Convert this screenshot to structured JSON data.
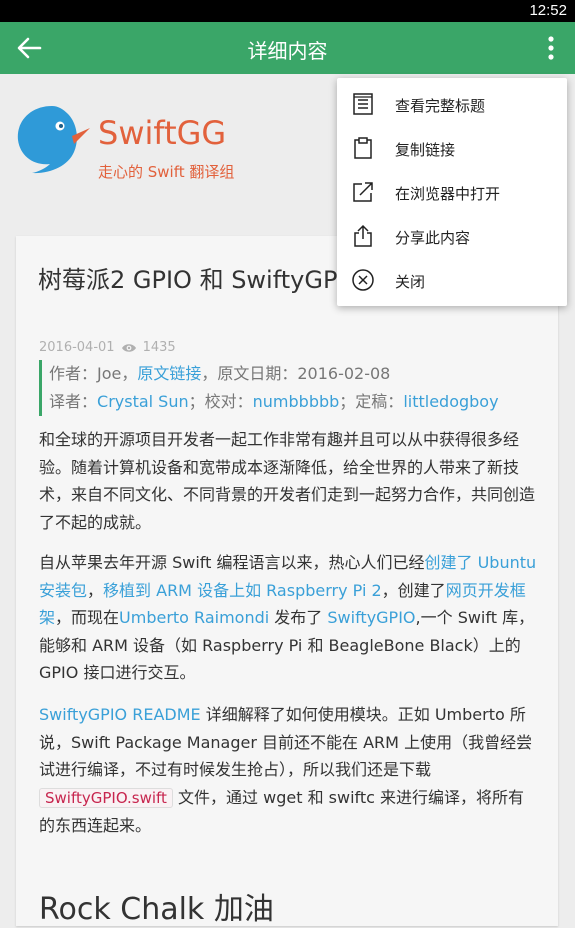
{
  "status_bar": {
    "time": "12:52"
  },
  "app_bar": {
    "title": "详细内容"
  },
  "brand": {
    "name": "SwiftGG",
    "tagline": "走心的 Swift 翻译组"
  },
  "article": {
    "title": "树莓派2 GPIO 和 SwiftyGPIO",
    "date": "2016-04-01",
    "views": "1435",
    "credits": {
      "author_prefix": "作者：Joe，",
      "original_link": "原文链接",
      "original_date": "，原文日期：2016-02-08",
      "translator_prefix": "译者：",
      "translator": "Crystal Sun",
      "proofreader_prefix": "；校对：",
      "proofreader": "numbbbbb",
      "finalizer_prefix": "；定稿：",
      "finalizer": "littledogboy"
    },
    "para1": "和全球的开源项目开发者一起工作非常有趣并且可以从中获得很多经验。随着计算机设备和宽带成本逐渐降低，给全世界的人带来了新技术，来自不同文化、不同背景的开发者们走到一起努力合作，共同创造了不起的成就。",
    "para2": {
      "t1": "自从苹果去年开源 Swift 编程语言以来，热心人们已经",
      "l1": "创建了 Ubuntu 安装包",
      "t2": "，",
      "l2": "移植到 ARM 设备上如 Raspberry Pi 2",
      "t3": "，创建了",
      "l3": "网页开发框架",
      "t4": "，而现在",
      "l4": "Umberto Raimondi",
      "t5": " 发布了 ",
      "l5": "SwiftyGPIO",
      "t6": ",一个 Swift 库，能够和 ARM 设备（如 Raspberry Pi 和 BeagleBone Black）上的 GPIO 接口进行交互。"
    },
    "para3": {
      "l1": "SwiftyGPIO README",
      "t1": " 详细解释了如何使用模块。正如 Umberto 所说，Swift Package Manager 目前还不能在 ARM 上使用（我曾经尝试进行编译，不过有时候发生抢占），所以我们还是下载 ",
      "code": "SwiftyGPIO.swift",
      "t2": " 文件，通过 wget 和 swiftc 来进行编译，将所有的东西连起来。"
    },
    "heading2": "Rock Chalk 加油"
  },
  "menu": {
    "items": [
      {
        "label": "查看完整标题",
        "icon": "full-title-icon"
      },
      {
        "label": "复制链接",
        "icon": "clipboard-icon"
      },
      {
        "label": "在浏览器中打开",
        "icon": "open-external-icon"
      },
      {
        "label": "分享此内容",
        "icon": "share-icon"
      },
      {
        "label": "关闭",
        "icon": "close-circle-icon"
      }
    ]
  },
  "colors": {
    "accent": "#3aa668",
    "brand": "#e2613c",
    "link": "#3aa0d8"
  }
}
